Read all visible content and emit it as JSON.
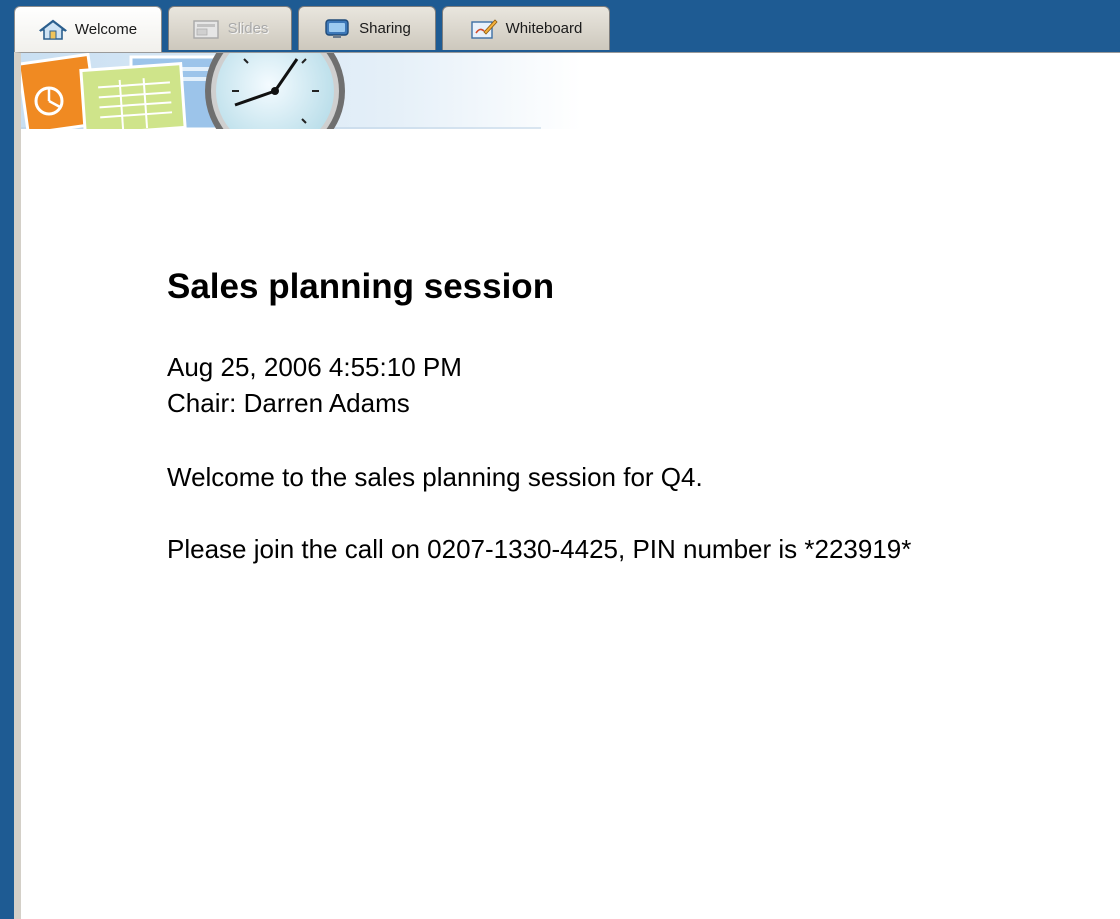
{
  "tabs": [
    {
      "label": "Welcome",
      "icon": "house-icon",
      "state": "active"
    },
    {
      "label": "Slides",
      "icon": "slides-icon",
      "state": "disabled"
    },
    {
      "label": "Sharing",
      "icon": "monitor-icon",
      "state": "normal"
    },
    {
      "label": "Whiteboard",
      "icon": "whiteboard-icon",
      "state": "normal"
    }
  ],
  "session": {
    "title": "Sales planning session",
    "datetime": "Aug 25, 2006 4:55:10 PM",
    "chair": "Chair: Darren Adams",
    "welcome": "Welcome to the sales planning session for Q4.",
    "call_info": "Please join the call on 0207-1330-4425, PIN number is *223919*"
  },
  "colors": {
    "background": "#1e5b93",
    "panel": "#ffffff",
    "tab_face": "#dedad2"
  }
}
